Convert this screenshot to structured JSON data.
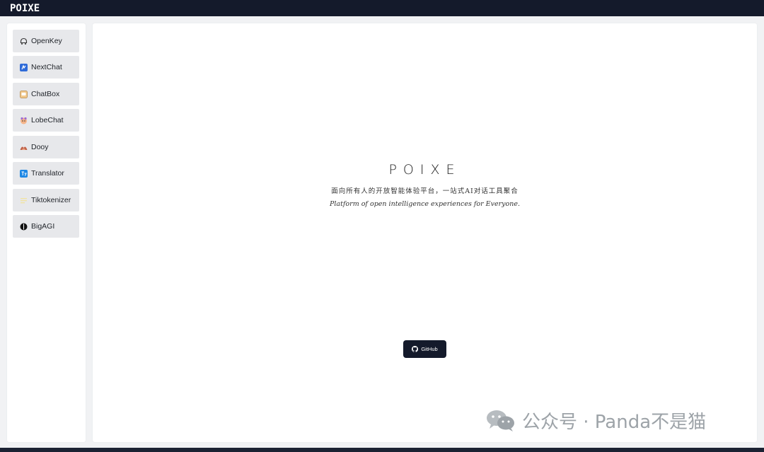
{
  "app": {
    "brand": "POIXE"
  },
  "sidebar": {
    "items": [
      {
        "label": "OpenKey",
        "icon": "openkey-icon"
      },
      {
        "label": "NextChat",
        "icon": "nextchat-icon"
      },
      {
        "label": "ChatBox",
        "icon": "chatbox-icon"
      },
      {
        "label": "LobeChat",
        "icon": "lobechat-icon"
      },
      {
        "label": "Dooy",
        "icon": "dooy-icon"
      },
      {
        "label": "Translator",
        "icon": "translator-icon"
      },
      {
        "label": "Tiktokenizer",
        "icon": "tiktokenizer-icon"
      },
      {
        "label": "BigAGI",
        "icon": "bigagi-icon"
      }
    ]
  },
  "main": {
    "title": "POIXE",
    "subtitle_cn": "面向所有人的开放智能体验平台，一站式AI对话工具聚合",
    "subtitle_en": "Platform of open intelligence experiences for Everyone.",
    "github_button": "GitHub"
  },
  "watermark": {
    "text": "公众号 · Panda不是猫"
  },
  "colors": {
    "topbar": "#141a2b",
    "accent_nextchat": "#2f6bd8",
    "accent_translator": "#1e88e5",
    "button_dark": "#141a2b"
  }
}
